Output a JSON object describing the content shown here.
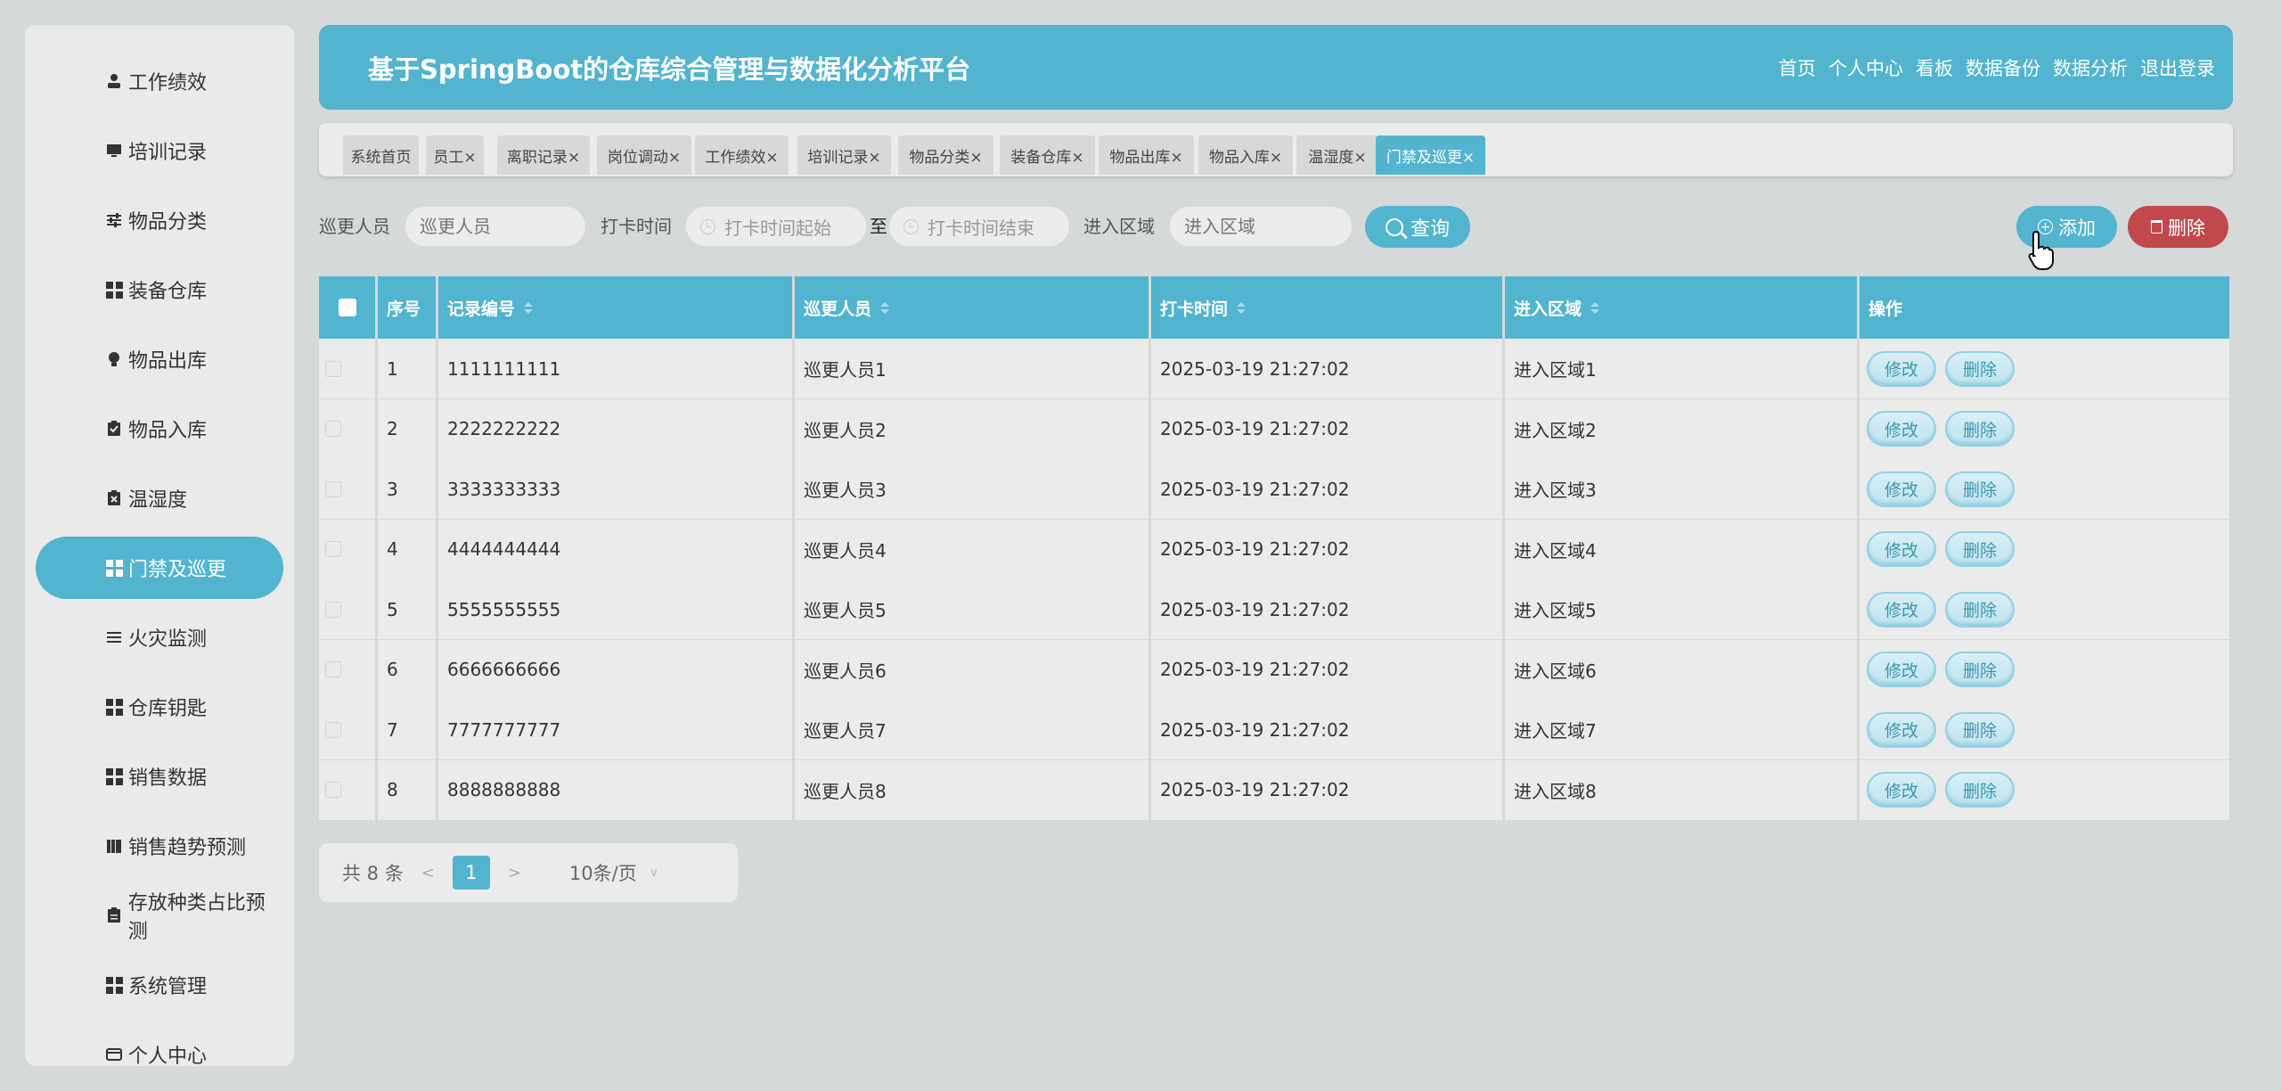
{
  "sidebar": {
    "items": [
      {
        "label": "工作绩效",
        "icon": "user-icon"
      },
      {
        "label": "培训记录",
        "icon": "monitor-icon"
      },
      {
        "label": "物品分类",
        "icon": "sliders-icon"
      },
      {
        "label": "装备仓库",
        "icon": "grid-icon"
      },
      {
        "label": "物品出库",
        "icon": "bulb-icon"
      },
      {
        "label": "物品入库",
        "icon": "clipboard-check-icon"
      },
      {
        "label": "温湿度",
        "icon": "clipboard-x-icon"
      },
      {
        "label": "门禁及巡更",
        "icon": "grid-icon",
        "active": true
      },
      {
        "label": "火灾监测",
        "icon": "list-icon"
      },
      {
        "label": "仓库钥匙",
        "icon": "grid-icon"
      },
      {
        "label": "销售数据",
        "icon": "grid-icon"
      },
      {
        "label": "销售趋势预测",
        "icon": "book-icon"
      },
      {
        "label": "存放种类占比预测",
        "icon": "clipboard-icon"
      },
      {
        "label": "系统管理",
        "icon": "grid-icon"
      },
      {
        "label": "个人中心",
        "icon": "card-icon"
      }
    ]
  },
  "header": {
    "title": "基于SpringBoot的仓库综合管理与数据化分析平台",
    "nav": [
      "首页",
      "个人中心",
      "看板",
      "数据备份",
      "数据分析",
      "退出登录"
    ]
  },
  "tabs": [
    {
      "label": "系统首页"
    },
    {
      "label": "员工×"
    },
    {
      "label": "离职记录×"
    },
    {
      "label": "岗位调动×"
    },
    {
      "label": "工作绩效×"
    },
    {
      "label": "培训记录×"
    },
    {
      "label": "物品分类×"
    },
    {
      "label": "装备仓库×"
    },
    {
      "label": "物品出库×"
    },
    {
      "label": "物品入库×"
    },
    {
      "label": "温湿度×"
    },
    {
      "label": "门禁及巡更×",
      "active": true
    }
  ],
  "search": {
    "patrol_label": "巡更人员",
    "patrol_placeholder": "巡更人员",
    "time_label": "打卡时间",
    "time_start_placeholder": "打卡时间起始",
    "to": "至",
    "time_end_placeholder": "打卡时间结束",
    "area_label": "进入区域",
    "area_placeholder": "进入区域",
    "query_button": "查询",
    "add_button": "添加",
    "delete_button": "删除"
  },
  "table": {
    "headers": {
      "index": "序号",
      "record_no": "记录编号",
      "patrol": "巡更人员",
      "time": "打卡时间",
      "area": "进入区域",
      "action": "操作"
    },
    "edit_label": "修改",
    "delete_label": "删除",
    "rows": [
      {
        "index": "1",
        "record_no": "1111111111",
        "patrol": "巡更人员1",
        "time": "2025-03-19 21:27:02",
        "area": "进入区域1"
      },
      {
        "index": "2",
        "record_no": "2222222222",
        "patrol": "巡更人员2",
        "time": "2025-03-19 21:27:02",
        "area": "进入区域2"
      },
      {
        "index": "3",
        "record_no": "3333333333",
        "patrol": "巡更人员3",
        "time": "2025-03-19 21:27:02",
        "area": "进入区域3"
      },
      {
        "index": "4",
        "record_no": "4444444444",
        "patrol": "巡更人员4",
        "time": "2025-03-19 21:27:02",
        "area": "进入区域4"
      },
      {
        "index": "5",
        "record_no": "5555555555",
        "patrol": "巡更人员5",
        "time": "2025-03-19 21:27:02",
        "area": "进入区域5"
      },
      {
        "index": "6",
        "record_no": "6666666666",
        "patrol": "巡更人员6",
        "time": "2025-03-19 21:27:02",
        "area": "进入区域6"
      },
      {
        "index": "7",
        "record_no": "7777777777",
        "patrol": "巡更人员7",
        "time": "2025-03-19 21:27:02",
        "area": "进入区域7"
      },
      {
        "index": "8",
        "record_no": "8888888888",
        "patrol": "巡更人员8",
        "time": "2025-03-19 21:27:02",
        "area": "进入区域8"
      }
    ]
  },
  "pager": {
    "total": "共 8 条",
    "prev": "<",
    "current": "1",
    "next": ">",
    "page_size": "10条/页"
  },
  "colors": {
    "accent": "#52b4cf",
    "danger": "#c1494b",
    "background": "#d5d9da",
    "panel": "#ebebeb"
  }
}
